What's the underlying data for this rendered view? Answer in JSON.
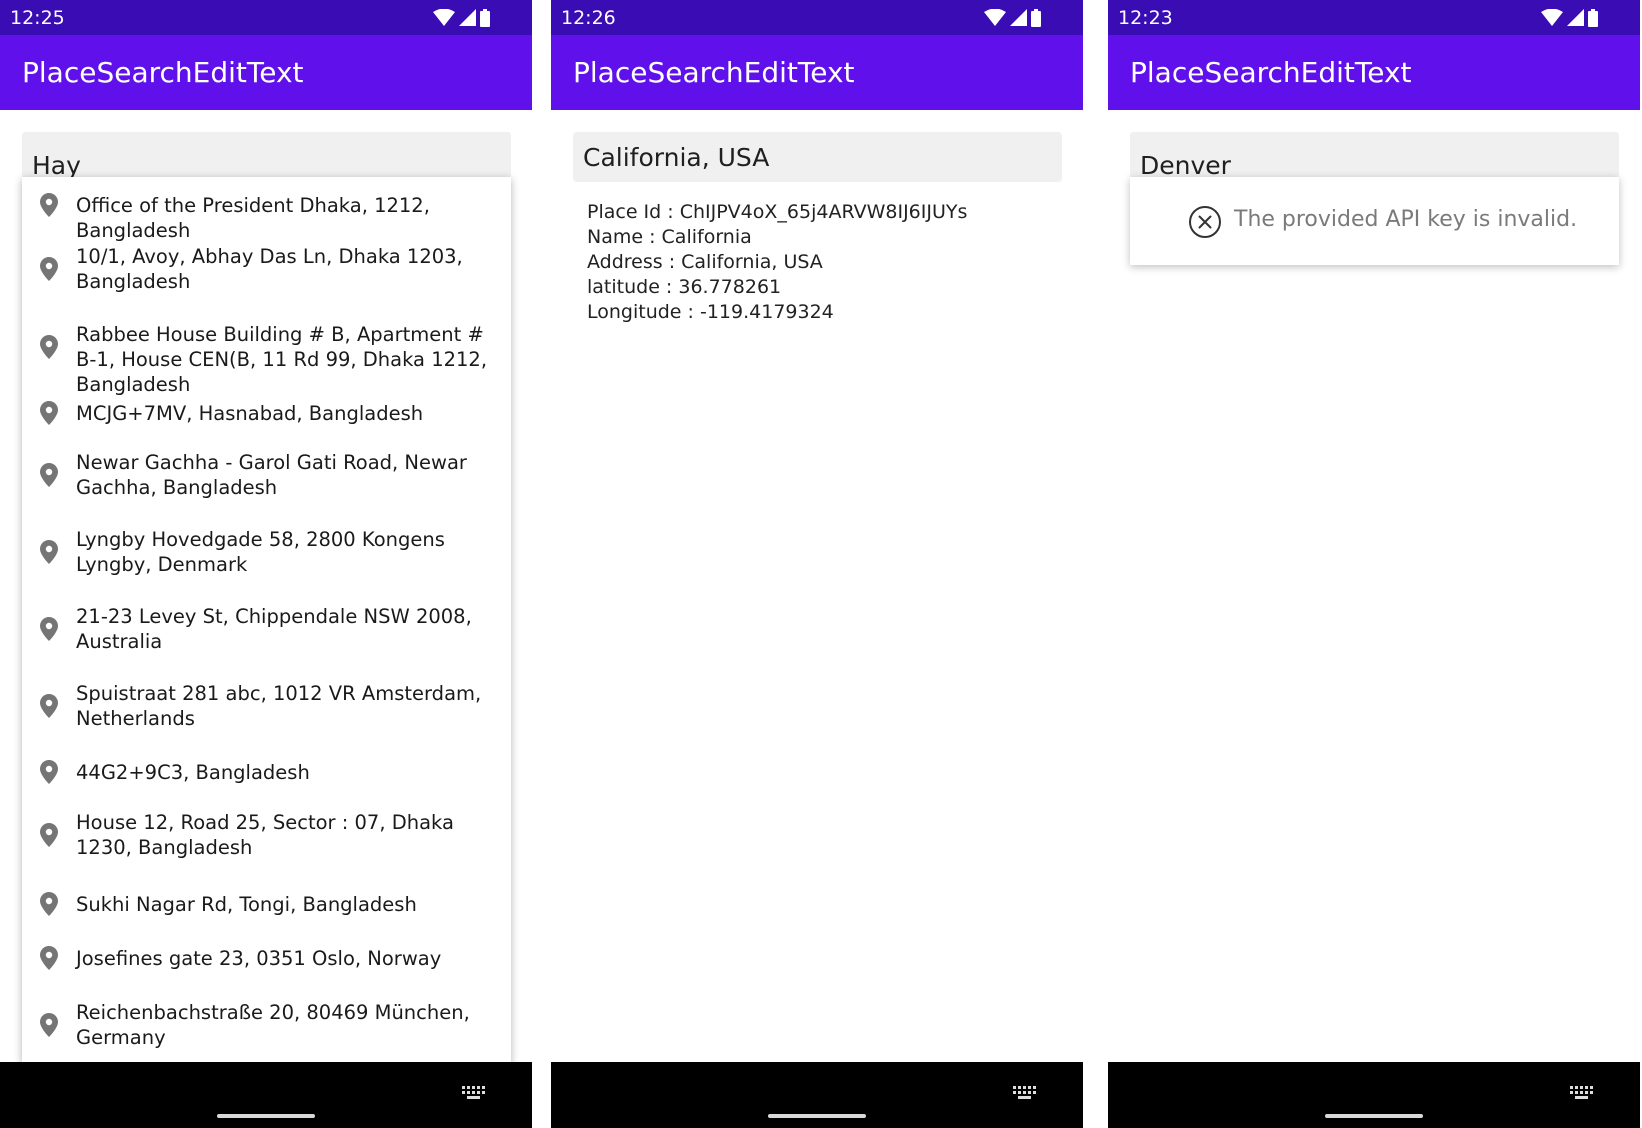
{
  "screens": [
    {
      "status_time": "12:25",
      "app_title": "PlaceSearchEditText",
      "search_value": "Hay",
      "suggestions": [
        "Office of the President Dhaka, 1212, Bangladesh",
        "10/1, Avoy, Abhay Das Ln, Dhaka 1203, Bangladesh",
        "Rabbee House Building # B, Apartment # B-1, House CEN(B, 11 Rd 99, Dhaka 1212, Bangladesh",
        "MCJG+7MV, Hasnabad, Bangladesh",
        "Newar Gachha - Garol Gati Road, Newar Gachha, Bangladesh",
        "Lyngby Hovedgade 58, 2800 Kongens Lyngby, Denmark",
        "21-23 Levey St, Chippendale NSW 2008, Australia",
        "Spuistraat 281 abc, 1012 VR Amsterdam, Netherlands",
        "44G2+9C3, Bangladesh",
        "House 12, Road 25, Sector : 07, Dhaka 1230, Bangladesh",
        "Sukhi Nagar Rd, Tongi, Bangladesh",
        "Josefines gate 23, 0351 Oslo, Norway",
        "Reichenbachstraße 20, 80469 München, Germany"
      ]
    },
    {
      "status_time": "12:26",
      "app_title": "PlaceSearchEditText",
      "search_value": "California, USA",
      "details": [
        "Place Id : ChIJPV4oX_65j4ARVW8IJ6IJUYs",
        "Name : California",
        "Address : California, USA",
        "latitude : 36.778261",
        "Longitude : -119.4179324"
      ]
    },
    {
      "status_time": "12:23",
      "app_title": "PlaceSearchEditText",
      "search_value": "Denver",
      "error_message": "The provided API key is invalid."
    }
  ],
  "icons": {
    "suggestion": "location-pin-icon",
    "error": "error-circle-x-icon",
    "status": [
      "wifi-icon",
      "cell-signal-icon",
      "battery-icon"
    ],
    "nav": [
      "home-pill",
      "keyboard-icon"
    ]
  },
  "colors": {
    "status_bar": "#3a0cb4",
    "app_bar": "#6010ea",
    "field_bg": "#f0f0f0"
  }
}
